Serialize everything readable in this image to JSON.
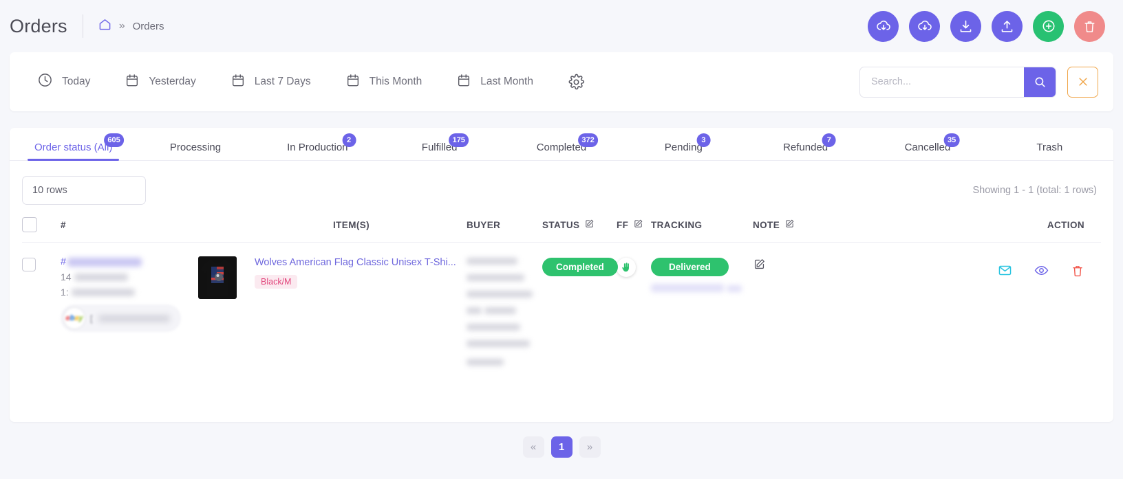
{
  "header": {
    "title": "Orders",
    "breadcrumb": {
      "home_icon": "home-icon",
      "separator": "»",
      "current": "Orders"
    },
    "actions": [
      {
        "name": "cloud-download-1",
        "icon": "cloud-download-icon",
        "color": "#6c63e8"
      },
      {
        "name": "cloud-download-2",
        "icon": "cloud-download-icon",
        "color": "#6c63e8"
      },
      {
        "name": "download",
        "icon": "download-icon",
        "color": "#6c63e8"
      },
      {
        "name": "upload",
        "icon": "upload-icon",
        "color": "#6c63e8"
      },
      {
        "name": "add-order",
        "icon": "plus-circle-icon",
        "color": "#28c172"
      },
      {
        "name": "delete-orders",
        "icon": "trash-icon",
        "color": "#f08a8a"
      }
    ]
  },
  "filters": {
    "quick": [
      {
        "label": "Today",
        "icon": "clock-icon"
      },
      {
        "label": "Yesterday",
        "icon": "calendar-icon"
      },
      {
        "label": "Last 7 Days",
        "icon": "calendar-icon"
      },
      {
        "label": "This Month",
        "icon": "calendar-icon"
      },
      {
        "label": "Last Month",
        "icon": "calendar-icon"
      }
    ],
    "settings_icon": "gear-icon",
    "search": {
      "placeholder": "Search...",
      "value": "",
      "button_icon": "search-icon"
    },
    "clear": {
      "icon": "close-icon",
      "border_color": "#f0a64a"
    }
  },
  "tabs": [
    {
      "label": "Order status (All)",
      "badge": "605",
      "active": true
    },
    {
      "label": "Processing",
      "badge": "",
      "active": false
    },
    {
      "label": "In Production",
      "badge": "2",
      "active": false
    },
    {
      "label": "Fulfilled",
      "badge": "175",
      "active": false
    },
    {
      "label": "Completed",
      "badge": "372",
      "active": false
    },
    {
      "label": "Pending",
      "badge": "3",
      "active": false
    },
    {
      "label": "Refunded",
      "badge": "7",
      "active": false
    },
    {
      "label": "Cancelled",
      "badge": "35",
      "active": false
    },
    {
      "label": "Trash",
      "badge": "",
      "active": false
    }
  ],
  "toolbar": {
    "rows_select_value": "10 rows",
    "showing_text": "Showing 1 - 1 (total: 1 rows)"
  },
  "table": {
    "columns": [
      {
        "label": "#",
        "edit_icon": false
      },
      {
        "label": "ITEM(S)",
        "edit_icon": false
      },
      {
        "label": "BUYER",
        "edit_icon": false
      },
      {
        "label": "STATUS",
        "edit_icon": true
      },
      {
        "label": "FF",
        "edit_icon": true
      },
      {
        "label": "TRACKING",
        "edit_icon": false
      },
      {
        "label": "NOTE",
        "edit_icon": true
      },
      {
        "label": "ACTION",
        "edit_icon": false
      }
    ],
    "rows": [
      {
        "order_number_prefix": "#",
        "line2_prefix": "14",
        "line3_prefix": "1:",
        "marketplace": "ebay",
        "marketplace_bracket": "[",
        "item_title": "Wolves American Flag Classic Unisex T-Shi...",
        "variant": "Black/M",
        "status": "Completed",
        "ff_icon": "fulfillment-hand-icon",
        "tracking": "Delivered",
        "note_icon": "edit-note-icon",
        "actions": [
          {
            "name": "email-order",
            "icon": "mail-icon",
            "color": "#29c4e0"
          },
          {
            "name": "view-order",
            "icon": "eye-icon",
            "color": "#6c63e8"
          },
          {
            "name": "delete-order",
            "icon": "trash-icon",
            "color": "#f2574c"
          }
        ]
      }
    ]
  },
  "pagination": {
    "prev_label": "«",
    "next_label": "»",
    "pages": [
      "1"
    ],
    "current": "1"
  },
  "colors": {
    "accent": "#6c63e8",
    "success": "#2ec26e",
    "danger": "#f08a8a",
    "warning": "#f0a64a"
  }
}
